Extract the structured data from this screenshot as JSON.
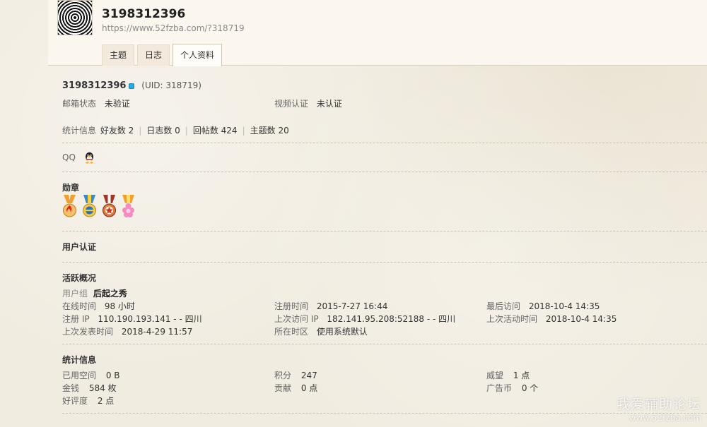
{
  "header": {
    "username": "3198312396",
    "url": "https://www.52fzba.com/?318719",
    "tabs": [
      {
        "label": "主题"
      },
      {
        "label": "日志"
      },
      {
        "label": "个人资料"
      }
    ]
  },
  "profile": {
    "name": "3198312396",
    "uid": "(UID: 318719)",
    "email_status_label": "邮箱状态",
    "email_status_value": "未验证",
    "video_auth_label": "视频认证",
    "video_auth_value": "未认证",
    "stats_label": "统计信息",
    "stats": [
      {
        "text": "好友数 2"
      },
      {
        "text": "日志数 0"
      },
      {
        "text": "回帖数 424"
      },
      {
        "text": "主题数 20"
      }
    ],
    "qq_label": "QQ"
  },
  "medals": {
    "title": "勋章",
    "items": [
      {
        "icon": "medal-flame-icon",
        "color": "#e8a13a"
      },
      {
        "icon": "medal-blue-icon",
        "color": "#2a7fc7"
      },
      {
        "icon": "medal-red-icon",
        "color": "#b43a2a"
      },
      {
        "icon": "medal-pink-icon",
        "color": "#e86aa8"
      }
    ]
  },
  "user_auth": {
    "title": "用户认证"
  },
  "activity": {
    "title": "活跃概况",
    "group_label": "用户组",
    "group_value": "后起之秀",
    "rows": [
      [
        {
          "label": "在线时间",
          "value": "98 小时"
        },
        {
          "label": "注册时间",
          "value": "2015-7-27 16:44"
        },
        {
          "label": "最后访问",
          "value": "2018-10-4 14:35"
        }
      ],
      [
        {
          "label": "注册 IP",
          "value": "110.190.193.141 - - 四川"
        },
        {
          "label": "上次访问 IP",
          "value": "182.141.95.208:52188 - - 四川"
        },
        {
          "label": "上次活动时间",
          "value": "2018-10-4 14:35"
        }
      ],
      [
        {
          "label": "上次发表时间",
          "value": "2018-4-29 11:57"
        },
        {
          "label": "所在时区",
          "value": "使用系统默认"
        }
      ]
    ]
  },
  "statistics": {
    "title": "统计信息",
    "rows": [
      [
        {
          "label": "已用空间",
          "value": "0 B"
        },
        {
          "label": "积分",
          "value": "247"
        },
        {
          "label": "威望",
          "value": "1 点"
        }
      ],
      [
        {
          "label": "金钱",
          "value": "584 枚"
        },
        {
          "label": "贡献",
          "value": "0 点"
        },
        {
          "label": "广告币",
          "value": "0 个"
        }
      ],
      [
        {
          "label": "好评度",
          "value": "2 点"
        }
      ]
    ]
  },
  "watermark": {
    "line1": "我爱辅助论坛",
    "line2": "www.52fzba.com"
  }
}
